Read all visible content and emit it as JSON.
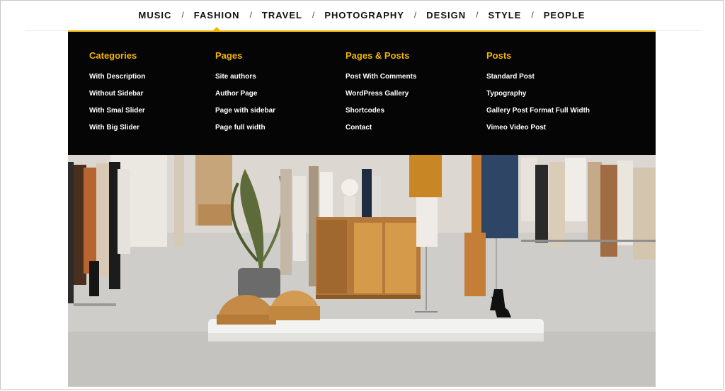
{
  "nav": {
    "items": [
      {
        "label": "MUSIC",
        "active": false
      },
      {
        "label": "FASHION",
        "active": true
      },
      {
        "label": "TRAVEL",
        "active": false
      },
      {
        "label": "PHOTOGRAPHY",
        "active": false
      },
      {
        "label": "DESIGN",
        "active": false
      },
      {
        "label": "STYLE",
        "active": false
      },
      {
        "label": "PEOPLE",
        "active": false
      }
    ],
    "separator": "/",
    "accent_color": "#f3b400"
  },
  "megamenu": {
    "background": "#050505",
    "columns": [
      {
        "title": "Categories",
        "links": [
          "With Description",
          "Without Sidebar",
          "With Smal Slider",
          "With Big Slider"
        ]
      },
      {
        "title": "Pages",
        "links": [
          "Site authors",
          "Author Page",
          "Page with sidebar",
          "Page full width"
        ]
      },
      {
        "title": "Pages & Posts",
        "links": [
          "Post With Comments",
          "WordPress Gallery",
          "Shortcodes",
          "Contact"
        ]
      },
      {
        "title": "Posts",
        "links": [
          "Standard Post",
          "Typography",
          "Gallery Post Format Full Width",
          "Vimeo Video Post"
        ]
      }
    ]
  }
}
